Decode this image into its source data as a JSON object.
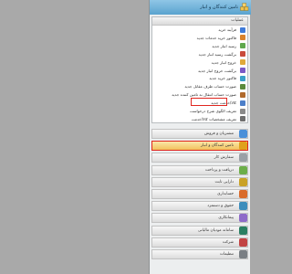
{
  "header": {
    "title": "تامین کنندگان و انبار",
    "logo_icon": "boxes-icon"
  },
  "section": {
    "title": "عملیات",
    "items": [
      {
        "label": "فرآیند خرید",
        "icon": "process-icon",
        "color": "#3f7bd9"
      },
      {
        "label": "فاکتور خرید خدمات جدید",
        "icon": "invoice-icon",
        "color": "#d9822b"
      },
      {
        "label": "رسید انبار جدید",
        "icon": "receipt-icon",
        "color": "#5fa84c"
      },
      {
        "label": "برگشت رسید انبار جدید",
        "icon": "return-icon",
        "color": "#c94a3b"
      },
      {
        "label": "خروج انبار جدید",
        "icon": "exit-icon",
        "color": "#e0a93a"
      },
      {
        "label": "برگشت خروج انبار جدید",
        "icon": "return-exit-icon",
        "color": "#7b59c6"
      },
      {
        "label": "فاکتور خرید جدید",
        "icon": "invoice-new-icon",
        "color": "#3aa0c9"
      },
      {
        "label": "صورت حساب طرف مقابل جدید",
        "icon": "statement-icon",
        "color": "#5a8a3c"
      },
      {
        "label": "صورت حساب انتقال به تامین کننده جدید",
        "icon": "transfer-icon",
        "color": "#b06a2c"
      },
      {
        "label": "کالا/خدمت جدید",
        "icon": "goods-icon",
        "color": "#4c7fc9"
      },
      {
        "label": "تعریف الگوی شرح درخواست",
        "icon": "template-icon",
        "color": "#8a8a8a"
      },
      {
        "label": "تعریف مشخصات کالا/خدمت",
        "icon": "spec-icon",
        "color": "#6e6e6e"
      }
    ]
  },
  "modules": [
    {
      "label": "مشتریان و فروش",
      "icon": "customers-icon",
      "color": "#4a90d9",
      "active": false
    },
    {
      "label": "تامین کنندگان و انبار",
      "icon": "suppliers-icon",
      "color": "#e0a11b",
      "active": true
    },
    {
      "label": "سفارش کار",
      "icon": "workorder-icon",
      "color": "#9aa0a6",
      "active": false
    },
    {
      "label": "دریافت و پرداخت",
      "icon": "payment-icon",
      "color": "#6cae4a",
      "active": false
    },
    {
      "label": "دارایی ثابت",
      "icon": "asset-icon",
      "color": "#c9a227",
      "active": false
    },
    {
      "label": "حسابداری",
      "icon": "accounting-icon",
      "color": "#d96b2b",
      "active": false
    },
    {
      "label": "حقوق و دستمزد",
      "icon": "payroll-icon",
      "color": "#3c8dbc",
      "active": false
    },
    {
      "label": "پیمانکاری",
      "icon": "contractor-icon",
      "color": "#8e6bc9",
      "active": false
    },
    {
      "label": "سامانه مودیان مالیاتی",
      "icon": "tax-icon",
      "color": "#2a7f62",
      "active": false
    },
    {
      "label": "شرکت",
      "icon": "company-icon",
      "color": "#c24444",
      "active": false
    },
    {
      "label": "تنظیمات",
      "icon": "settings-icon",
      "color": "#7a7f84",
      "active": false
    }
  ]
}
